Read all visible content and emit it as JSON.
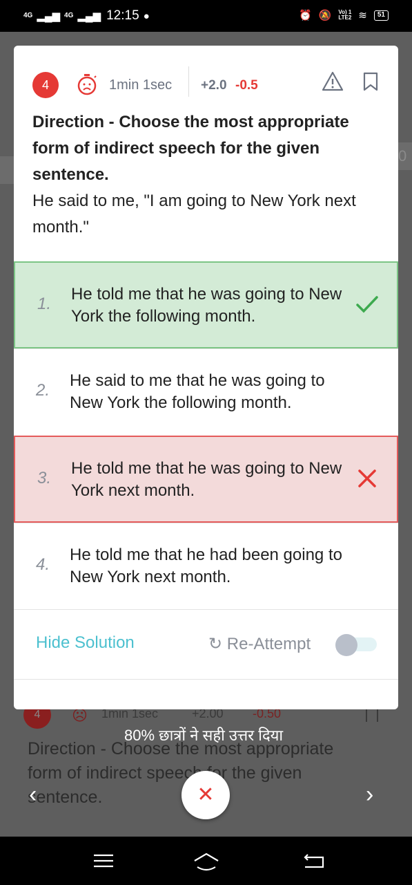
{
  "status_bar": {
    "signal1": "4G",
    "signal2": "4G",
    "time": "12:15",
    "lte_label": "Vo) 1\nLTE2",
    "battery": "51"
  },
  "background": {
    "question_number": "4",
    "time": "1min 1sec",
    "plus_marks": "+2.00",
    "minus_marks": "-0.50",
    "direction": "Direction - Choose the most appropriate form of indirect speech for the given sentence.",
    "right_edge_digit": "0"
  },
  "question": {
    "number": "4",
    "time": "1min 1sec",
    "plus_marks": "+2.0",
    "minus_marks": "-0.5",
    "direction": "Direction - Choose the most appropriate form of indirect speech for the given sentence.",
    "text": "He said to me, \"I am going to New York next month.\""
  },
  "options": [
    {
      "number": "1.",
      "text": "He told me that he was going to New York the following month.",
      "status": "correct"
    },
    {
      "number": "2.",
      "text": "He said to me that he was going to New York the following month.",
      "status": "none"
    },
    {
      "number": "3.",
      "text": "He told me that  he was going to New York next month.",
      "status": "wrong"
    },
    {
      "number": "4.",
      "text": "He told me that he had been going to New York next month.",
      "status": "none"
    }
  ],
  "actions": {
    "hide_solution": "Hide Solution",
    "re_attempt": "Re-Attempt"
  },
  "footer": {
    "correct_percent_text": "80% छात्रों ने सही उत्तर दिया",
    "prev": "‹",
    "next": "›",
    "close": "✕"
  },
  "colors": {
    "accent_teal": "#4cc0cf",
    "correct_green": "#d3ebd6",
    "wrong_red": "#f3dada",
    "badge_red": "#e53935"
  }
}
